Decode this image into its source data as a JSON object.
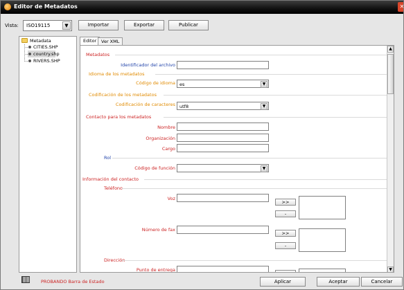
{
  "window": {
    "title": "Editor de Metadatos",
    "close_glyph": "✕"
  },
  "toolbar": {
    "vista_label": "Vista:",
    "vista_value": "ISO19115",
    "importar": "Importar",
    "exportar": "Exportar",
    "publicar": "Publicar"
  },
  "tree": {
    "root": "Metadata",
    "items": [
      "CITIES.SHP",
      "country.shp",
      "RIVERS.SHP"
    ],
    "selected_index": 1
  },
  "tabs": [
    "Editor",
    "Ver XML"
  ],
  "form": {
    "metadatos": "Metadatos",
    "identificador": "Identificador del archivo",
    "idioma_section": "Idioma de los metadatos",
    "idioma_label": "Código de idioma",
    "idioma_value": "es",
    "codificacion_section": "Codificación de los metadatos",
    "codificacion_label": "Codificación de caracteres",
    "codificacion_value": "utf8",
    "contacto": "Contacto para los metadatos",
    "nombre": "Nombre",
    "organizacion": "Organización",
    "cargo": "Cargo",
    "rol": "Rol",
    "codigo_funcion": "Código de función",
    "info_contacto": "Información del contacto",
    "telefono": "Teléfono",
    "voz": "Voz",
    "fax": "Número de fax",
    "add_btn": ">>",
    "remove_btn": "-",
    "direccion": "Dirección",
    "punto_entrega": "Punto de entrega"
  },
  "colors": {
    "red_label": "#cc2222",
    "blue_label": "#2244aa",
    "orange_label": "#e08a00",
    "status_red": "#cc2222"
  },
  "status": {
    "text": "PROBANDO Barra de Estado"
  },
  "footer": {
    "aplicar": "Aplicar",
    "aceptar": "Aceptar",
    "cancelar": "Cancelar"
  }
}
